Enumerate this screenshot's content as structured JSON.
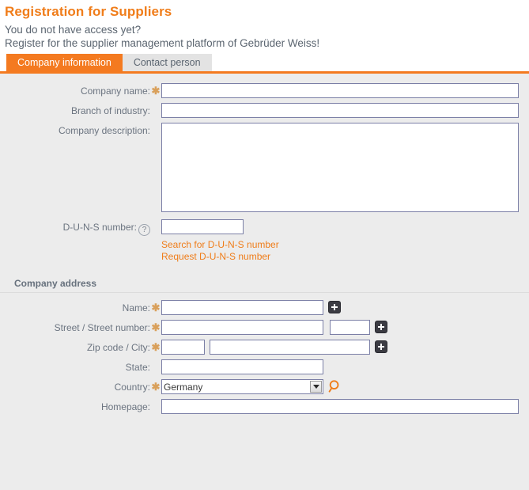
{
  "header": {
    "title": "Registration for Suppliers",
    "subtitle_line1": "You do not have access yet?",
    "subtitle_line2": "Register for the supplier management platform of Gebrüder Weiss!"
  },
  "tabs": [
    {
      "label": "Company information",
      "active": true
    },
    {
      "label": "Contact person",
      "active": false
    }
  ],
  "company_information": {
    "fields": {
      "company_name": {
        "label": "Company name:",
        "required": true,
        "value": "",
        "placeholder": ""
      },
      "branch_of_industry": {
        "label": "Branch of industry:",
        "required": false,
        "value": "",
        "placeholder": ""
      },
      "company_description": {
        "label": "Company description:",
        "required": false,
        "value": "",
        "placeholder": ""
      },
      "duns_number": {
        "label": "D-U-N-S number:",
        "required": false,
        "value": "",
        "placeholder": "",
        "help_icon": "question-mark-icon"
      }
    },
    "links": [
      {
        "label": "Search for D-U-N-S number"
      },
      {
        "label": "Request D-U-N-S number"
      }
    ]
  },
  "company_address": {
    "heading": "Company address",
    "fields": {
      "name": {
        "label": "Name:",
        "required": true,
        "value": "",
        "add_icon": "plus-icon"
      },
      "street": {
        "label": "Street / Street number:",
        "required": true,
        "street_value": "",
        "number_value": "",
        "add_icon": "plus-icon"
      },
      "zip_city": {
        "label": "Zip code / City:",
        "required": true,
        "zip_value": "",
        "city_value": "",
        "add_icon": "plus-icon"
      },
      "state": {
        "label": "State:",
        "required": false,
        "value": ""
      },
      "country": {
        "label": "Country:",
        "required": true,
        "value": "Germany",
        "options": [
          "Germany"
        ],
        "search_icon": "magnifier-icon"
      },
      "homepage": {
        "label": "Homepage:",
        "required": false,
        "value": ""
      }
    }
  },
  "colors": {
    "accent_orange": "#f47a20",
    "title_orange": "#f07d1a",
    "link_orange": "#ef7d1a",
    "body_background": "#ececec",
    "label_gray": "#6b7480",
    "input_border": "#7b7fa6",
    "required_asterisk": "#d9a05b",
    "tab_inactive_background": "#e3e3e3"
  }
}
